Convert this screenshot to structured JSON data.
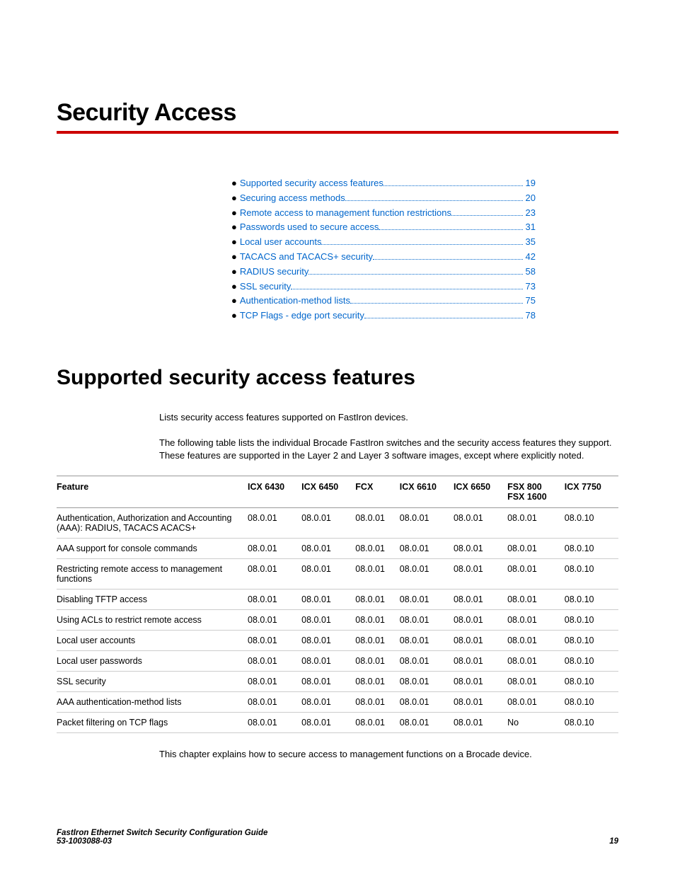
{
  "chapter_title": "Security Access",
  "toc": [
    {
      "label": "Supported security access features",
      "page": "19"
    },
    {
      "label": "Securing access methods",
      "page": "20"
    },
    {
      "label": "Remote access to management function restrictions",
      "page": "23"
    },
    {
      "label": "Passwords used to secure access",
      "page": "31"
    },
    {
      "label": "Local user accounts",
      "page": "35"
    },
    {
      "label": "TACACS and TACACS+ security",
      "page": "42"
    },
    {
      "label": "RADIUS security",
      "page": "58"
    },
    {
      "label": "SSL security",
      "page": "73"
    },
    {
      "label": "Authentication-method lists",
      "page": "75"
    },
    {
      "label": "TCP Flags - edge port security",
      "page": "78"
    }
  ],
  "section_title": "Supported security access features",
  "intro_text": "Lists security access features supported on FastIron devices.",
  "body_text": "The following table lists the individual Brocade FastIron switches and the security access features they support. These features are supported in the Layer 2 and Layer 3 software images, except where explicitly noted.",
  "table": {
    "headers": [
      "Feature",
      "ICX 6430",
      "ICX 6450",
      "FCX",
      "ICX 6610",
      "ICX 6650",
      "FSX 800 FSX 1600",
      "ICX 7750"
    ],
    "rows": [
      [
        "Authentication, Authorization and Accounting (AAA): RADIUS, TACACS ACACS+",
        "08.0.01",
        "08.0.01",
        "08.0.01",
        "08.0.01",
        "08.0.01",
        "08.0.01",
        "08.0.10"
      ],
      [
        "AAA support for console commands",
        "08.0.01",
        "08.0.01",
        "08.0.01",
        "08.0.01",
        "08.0.01",
        "08.0.01",
        "08.0.10"
      ],
      [
        "Restricting remote access to management functions",
        "08.0.01",
        "08.0.01",
        "08.0.01",
        "08.0.01",
        "08.0.01",
        "08.0.01",
        "08.0.10"
      ],
      [
        "Disabling TFTP access",
        "08.0.01",
        "08.0.01",
        "08.0.01",
        "08.0.01",
        "08.0.01",
        "08.0.01",
        "08.0.10"
      ],
      [
        "Using ACLs to restrict remote access",
        "08.0.01",
        "08.0.01",
        "08.0.01",
        "08.0.01",
        "08.0.01",
        "08.0.01",
        "08.0.10"
      ],
      [
        "Local user accounts",
        "08.0.01",
        "08.0.01",
        "08.0.01",
        "08.0.01",
        "08.0.01",
        "08.0.01",
        "08.0.10"
      ],
      [
        "Local user passwords",
        "08.0.01",
        "08.0.01",
        "08.0.01",
        "08.0.01",
        "08.0.01",
        "08.0.01",
        "08.0.10"
      ],
      [
        "SSL security",
        "08.0.01",
        "08.0.01",
        "08.0.01",
        "08.0.01",
        "08.0.01",
        "08.0.01",
        "08.0.10"
      ],
      [
        "AAA authentication-method lists",
        "08.0.01",
        "08.0.01",
        "08.0.01",
        "08.0.01",
        "08.0.01",
        "08.0.01",
        "08.0.10"
      ],
      [
        "Packet filtering on TCP flags",
        "08.0.01",
        "08.0.01",
        "08.0.01",
        "08.0.01",
        "08.0.01",
        "No",
        "08.0.10"
      ]
    ]
  },
  "explain_text": "This chapter explains how to secure access to management functions on a Brocade device.",
  "footer": {
    "title": "FastIron Ethernet Switch Security Configuration Guide",
    "doc_id": "53-1003088-03",
    "page_num": "19"
  }
}
